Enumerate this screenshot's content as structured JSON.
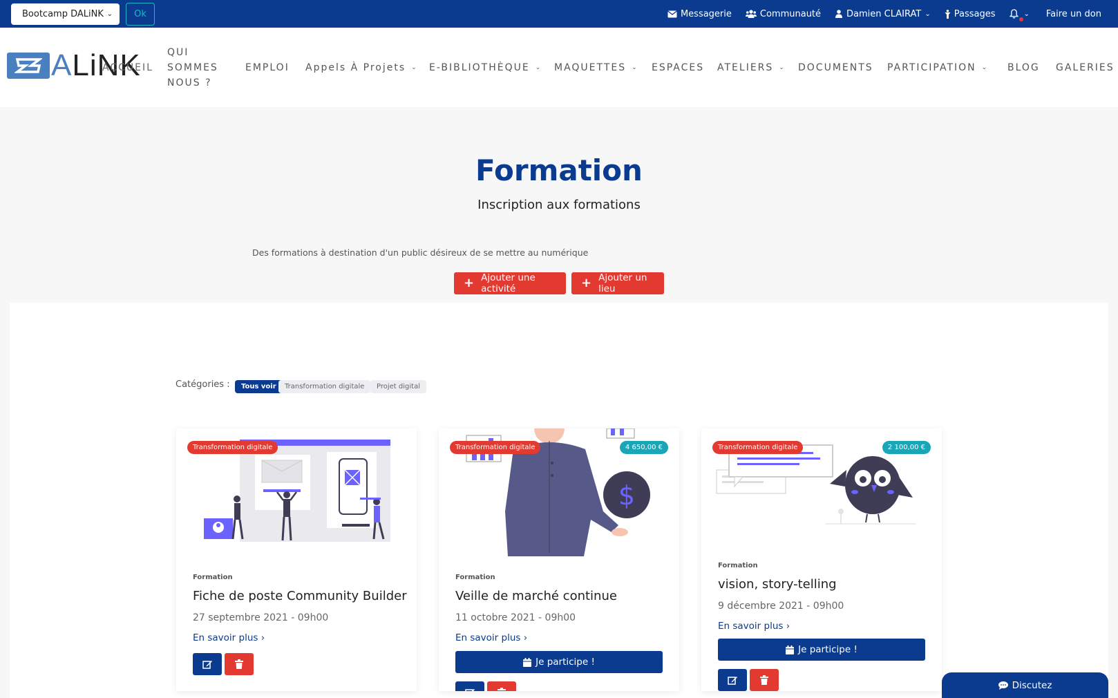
{
  "topbar": {
    "space_select": "Bootcamp DALiNK",
    "ok_label": "Ok",
    "links": {
      "messagerie": "Messagerie",
      "communaute": "Communauté",
      "user": "Damien CLAIRAT",
      "passages": "Passages",
      "don": "Faire un don"
    }
  },
  "logo": {
    "a": "A",
    "rest": "LiNK"
  },
  "nav": {
    "accueil": "ACCUEIL",
    "qui": "QUI SOMMES NOUS ?",
    "emploi": "EMPLOI",
    "appels": "Appels À Projets",
    "ebiblio": "E-BIBLIOTHÈQUE",
    "maquettes": "MAQUETTES",
    "espaces": "ESPACES",
    "ateliers": "ATELIERS",
    "documents": "DOCUMENTS",
    "participation": "PARTICIPATION",
    "blog": "BLOG",
    "galeries": "GALERIES"
  },
  "hero": {
    "title": "Formation",
    "subtitle": "Inscription aux formations",
    "description": "Des formations à destination d'un public désireux de se mettre au numérique",
    "add_activity": "Ajouter une activité",
    "add_place": "Ajouter un lieu"
  },
  "categories": {
    "label": "Catégories :",
    "all": "Tous voir",
    "items": [
      "Transformation digitale",
      "Projet digital"
    ]
  },
  "cards": [
    {
      "tag": "Transformation digitale",
      "price": "",
      "type": "Formation",
      "title": "Fiche de poste Community Builder",
      "date": "27 septembre 2021 - 09h00",
      "more": "En savoir plus",
      "participe": ""
    },
    {
      "tag": "Transformation digitale",
      "price": "4 650,00 €",
      "type": "Formation",
      "title": "Veille de marché continue",
      "date": "11 octobre 2021 - 09h00",
      "more": "En savoir plus",
      "participe": "Je participe !"
    },
    {
      "tag": "Transformation digitale",
      "price": "2 100,00 €",
      "type": "Formation",
      "title": "vision, story-telling",
      "date": "9 décembre 2021 - 09h00",
      "more": "En savoir plus",
      "participe": "Je participe !"
    }
  ],
  "chat": {
    "label": "Discutez"
  },
  "colors": {
    "primary": "#0a3b8f",
    "danger": "#e23a31",
    "teal": "#1aa6b7",
    "accent": "#6c63ff"
  }
}
